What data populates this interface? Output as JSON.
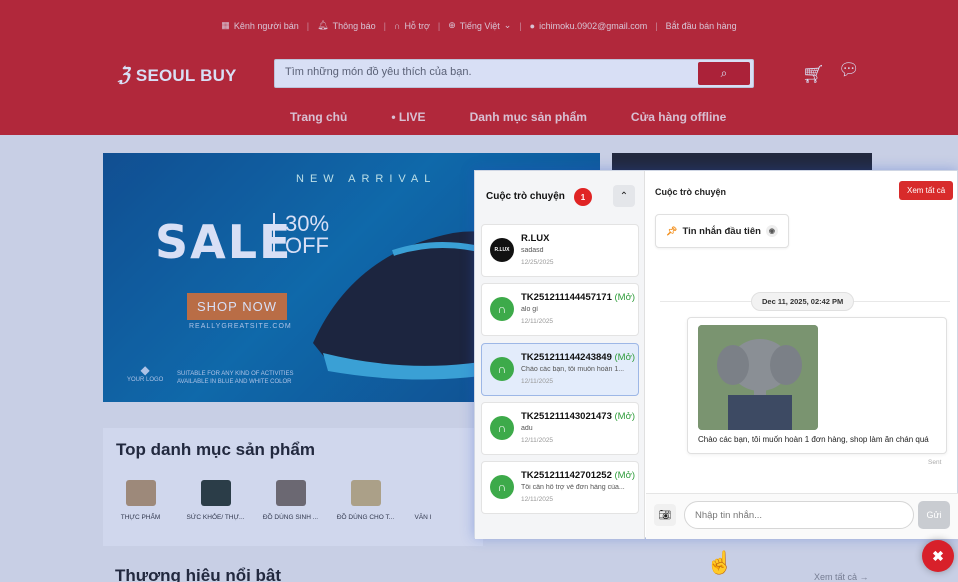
{
  "topbar": {
    "seller": "Kênh người bán",
    "notifications": "Thông báo",
    "support": "Hỗ trợ",
    "language": "Tiếng Việt",
    "email": "ichimoku.0902@gmail.com",
    "start_selling": "Bắt đầu bán hàng"
  },
  "header": {
    "logo": "SEOUL BUY",
    "search_placeholder": "Tìm những món đồ yêu thích của bạn.",
    "nav": [
      "Trang chủ",
      "LIVE",
      "Danh mục sản phẩm",
      "Cửa hàng offline"
    ]
  },
  "banner": {
    "new_arrival": "NEW ARRIVAL",
    "sale": "SALE",
    "percent": "30%",
    "off": "OFF",
    "shop_now": "SHOP NOW",
    "site": "REALLYGREATSITE.COM",
    "suitable_1": "SUITABLE FOR ANY KIND OF ACTIVITIES",
    "suitable_2": "AVAILABLE IN BLUE AND WHITE COLOR",
    "your_logo": "YOUR LOGO"
  },
  "categories": {
    "title": "Top danh mục sản phẩm",
    "items": [
      "THỰC PHẨM",
      "SỨC KHỎE/ THỰ...",
      "ĐỒ DÙNG SINH ...",
      "ĐỒ DÙNG CHO T...",
      "VĂN I"
    ]
  },
  "brands": {
    "title": "Thương hiệu nổi bật",
    "see_all": "Xem tất cả →"
  },
  "chat": {
    "list_title": "Cuộc trò chuyện",
    "unread": "1",
    "conversations": [
      {
        "name": "R.LUX",
        "tag": "",
        "message": "sadasd",
        "date": "12/25/2025"
      },
      {
        "name": "TK251211144457171",
        "tag": "(Mở)",
        "message": "alo gì",
        "date": "12/11/2025"
      },
      {
        "name": "TK251211144243849",
        "tag": "(Mở)",
        "message": "Chào các bạn, tôi muốn hoàn 1...",
        "date": "12/11/2025"
      },
      {
        "name": "TK251211143021473",
        "tag": "(Mở)",
        "message": "adu",
        "date": "12/11/2025"
      },
      {
        "name": "TK251211142701252",
        "tag": "(Mở)",
        "message": "Tôi cần hỗ trợ về đơn hàng của...",
        "date": "12/11/2025"
      }
    ],
    "panel_title": "Cuộc trò chuyện",
    "view_all": "Xem tất cả",
    "first_message": "Tin nhắn đầu tiên",
    "date_separator": "Dec 11, 2025, 02:42 PM",
    "message_text": "Chào các bạn, tôi muốn hoàn 1 đơn hàng, shop làm ăn chán quá",
    "status": "Sent",
    "input_placeholder": "Nhập tin nhắn...",
    "send": "Gửi"
  }
}
